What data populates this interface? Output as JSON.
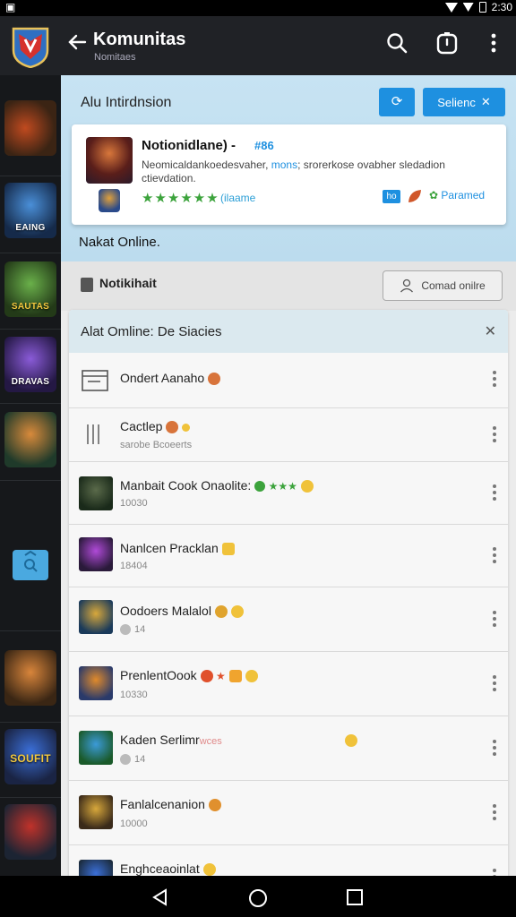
{
  "statusbar": {
    "time": "2:30"
  },
  "appbar": {
    "title": "Komunitas",
    "subtitle": "Nomitaes"
  },
  "rail": {
    "items": [
      {
        "label": "",
        "icon": "hammer-game-icon"
      },
      {
        "label": "EAING",
        "icon": "knight-game-icon"
      },
      {
        "label": "SAUTAS",
        "icon": "squad-game-icon"
      },
      {
        "label": "DRAVAS",
        "icon": "mage-game-icon"
      },
      {
        "label": "",
        "icon": "archer-game-icon"
      },
      {
        "label": "",
        "icon": "warrior-game-icon"
      },
      {
        "label": "SOUFIT",
        "icon": "shield-game-icon"
      },
      {
        "label": "",
        "icon": "soldier-game-icon"
      }
    ]
  },
  "hero": {
    "title": "Alu Intirdnsion",
    "select_label": "Selienc",
    "status": "Nakat Online."
  },
  "card": {
    "title": "Notionidlane) -",
    "tag": "#86",
    "desc_main": "Neomicaldankoedesvaher, ",
    "desc_highlight": "mons",
    "desc_rest": "; srorerkose ovabher sledadion ctievdation.",
    "stars": "★★★★★★",
    "rating": "(ilaame",
    "chip": "ho",
    "right_label": "Paramed"
  },
  "notif": {
    "label": "Notikihait",
    "contact_label": "Comad onilre"
  },
  "list": {
    "title": "Alat Omline: De Siacies",
    "rows": [
      {
        "title": "Ondert Aanaho",
        "sub": ""
      },
      {
        "title": "Cactlep",
        "sub": "sarobe Bcoeerts"
      },
      {
        "title": "Manbait Cook Onaolite:",
        "sub": "10030"
      },
      {
        "title": "Nanlcen Pracklan",
        "sub": "18404"
      },
      {
        "title": "Oodoers Malalol",
        "sub": "14"
      },
      {
        "title": "PrenlentOook",
        "sub": "10330"
      },
      {
        "title": "Kaden Serlimr",
        "sub": "14",
        "extra": "wces"
      },
      {
        "title": "Fanlalcenanion",
        "sub": "10000"
      },
      {
        "title": "Enghceaoinlat",
        "sub": ""
      }
    ]
  },
  "colors": {
    "accent": "#1e90e0",
    "hero_bg": "#c7e3f3",
    "star_green": "#3ca33c"
  }
}
